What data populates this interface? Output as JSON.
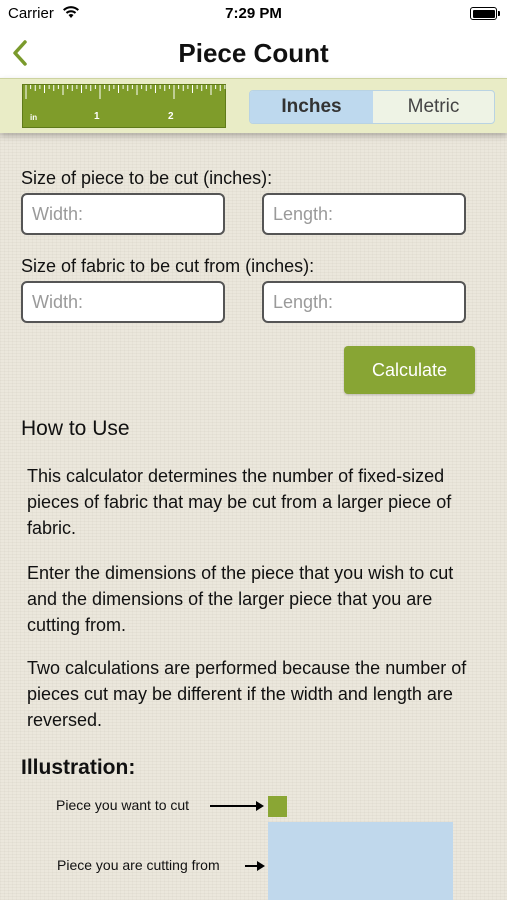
{
  "status_bar": {
    "carrier": "Carrier",
    "time": "7:29 PM",
    "battery_level": 1.0
  },
  "nav": {
    "back_icon": "chevron-left-icon",
    "title": "Piece Count"
  },
  "toolbar": {
    "ruler": {
      "unit_label": "in",
      "mark_1": "1",
      "mark_2": "2"
    },
    "units": {
      "active": "Inches",
      "inactive": "Metric"
    }
  },
  "form": {
    "piece_label": "Size of piece to be cut (inches):",
    "piece_width_placeholder": "Width:",
    "piece_length_placeholder": "Length:",
    "fabric_label": "Size of fabric to be cut from (inches):",
    "fabric_width_placeholder": "Width:",
    "fabric_length_placeholder": "Length:",
    "calculate_label": "Calculate"
  },
  "how_to": {
    "heading": "How to Use",
    "p1": "This calculator determines the number of fixed-sized pieces of fabric that may be cut from a larger piece of fabric.",
    "p2": "Enter the dimensions of the piece that you wish to cut and the dimensions of the larger piece that you are cutting from.",
    "p3": "Two calculations are performed because the number of pieces cut may be different if the width and length are reversed."
  },
  "illustration": {
    "heading": "Illustration:",
    "piece_label": "Piece you want to cut",
    "fabric_label": "Piece you are cutting from"
  },
  "colors": {
    "accent_green": "#88a534",
    "back_green": "#7a9a2c",
    "segment_active": "#bed9ee",
    "fabric_blue": "#c0d8ec"
  }
}
